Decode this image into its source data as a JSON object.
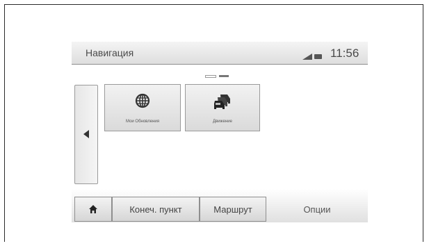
{
  "header": {
    "title": "Навигация",
    "time": "11:56",
    "icons": [
      "signal-icon",
      "battery-icon"
    ]
  },
  "page_indicator": {
    "pages": 2,
    "active_index": 1
  },
  "back_button": {
    "icon": "left-arrow-icon"
  },
  "tiles": [
    {
      "label": "Мои Обновления",
      "icon": "globe-icon"
    },
    {
      "label": "Движение",
      "icon": "traffic-cars-icon"
    }
  ],
  "bottom_bar": {
    "home_icon": "home-icon",
    "destination_label": "Конеч. пункт",
    "route_label": "Маршрут",
    "options_label": "Опции"
  }
}
